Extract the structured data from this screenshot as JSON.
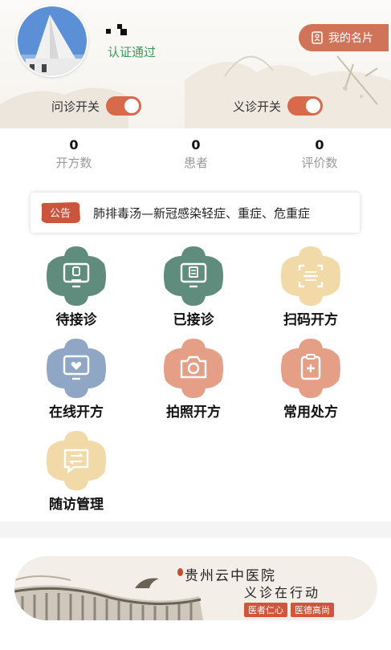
{
  "profile": {
    "verify_text": "认证通过",
    "card_button": "我的名片"
  },
  "switches": [
    {
      "label": "问诊开关",
      "on": true
    },
    {
      "label": "义诊开关",
      "on": true
    }
  ],
  "stats": [
    {
      "value": "0",
      "label": "开方数"
    },
    {
      "value": "0",
      "label": "患者"
    },
    {
      "value": "0",
      "label": "评价数"
    }
  ],
  "notice": {
    "tag": "公告",
    "text": "肺排毒汤—新冠感染轻症、重症、危重症"
  },
  "menu": [
    {
      "label": "待接诊",
      "icon": "patient-monitor-icon",
      "color": "#5f8c7d"
    },
    {
      "label": "已接诊",
      "icon": "document-monitor-icon",
      "color": "#5f8c7d"
    },
    {
      "label": "扫码开方",
      "icon": "scan-icon",
      "color": "#f1d9a8"
    },
    {
      "label": "在线开方",
      "icon": "heart-monitor-icon",
      "color": "#8fa6c4"
    },
    {
      "label": "拍照开方",
      "icon": "camera-icon",
      "color": "#e59f87"
    },
    {
      "label": "常用处方",
      "icon": "clipboard-plus-icon",
      "color": "#e59f87"
    },
    {
      "label": "随访管理",
      "icon": "chat-arrows-icon",
      "color": "#f1d9a8"
    }
  ],
  "banner": {
    "title": "贵州云中医院",
    "subtitle": "义诊在行动",
    "tags": [
      "医者仁心",
      "医德高尚"
    ]
  },
  "colors": {
    "accent": "#d8694a",
    "green": "#3a9a5a",
    "teal": "#5f8c7d",
    "blue": "#8fa6c4",
    "salmon": "#e59f87",
    "sand": "#f1d9a8"
  }
}
